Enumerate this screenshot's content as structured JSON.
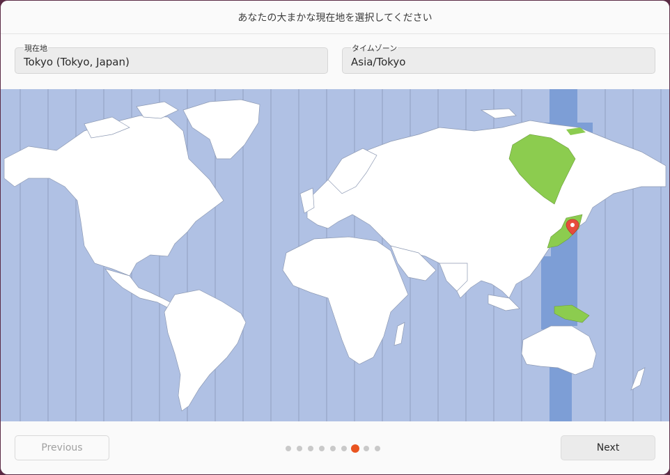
{
  "window": {
    "title": "あなたの大まかな現在地を選択してください"
  },
  "location": {
    "label": "現在地",
    "value": "Tokyo (Tokyo, Japan)"
  },
  "timezone": {
    "label": "タイムゾーン",
    "value": "Asia/Tokyo"
  },
  "map": {
    "selected_zone": "Asia/Tokyo",
    "colors": {
      "ocean": "#b0c1e4",
      "land": "#ffffff",
      "selected_band": "#7d9ed6",
      "highlight_land": "#8ccc4f",
      "pin": "#e74c3c"
    }
  },
  "footer": {
    "previous_label": "Previous",
    "next_label": "Next",
    "progress": {
      "total_steps": 9,
      "current_step": 7
    }
  }
}
